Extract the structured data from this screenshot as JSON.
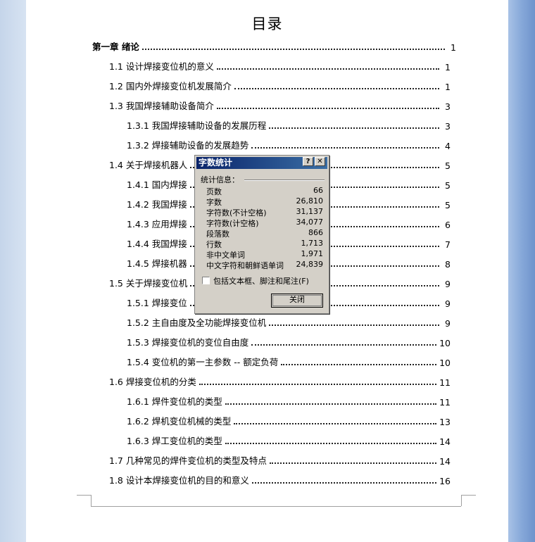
{
  "document": {
    "title": "目录",
    "toc": [
      {
        "text": "第一章  绪论",
        "page": "1"
      },
      {
        "text": "1.1 设计焊接变位机的意义",
        "page": "1"
      },
      {
        "text": "1.2 国内外焊接变位机发展简介",
        "page": "1"
      },
      {
        "text": "1.3 我国焊接辅助设备简介",
        "page": "3"
      },
      {
        "text": "1.3.1 我国焊接辅助设备的发展历程",
        "page": "3"
      },
      {
        "text": "1.3.2 焊接辅助设备的发展趋势",
        "page": "4"
      },
      {
        "text": "1.4 关于焊接机器人",
        "page": "5"
      },
      {
        "text": "1.4.1 国内焊接",
        "page": "5"
      },
      {
        "text": "1.4.2 我国焊接",
        "page": "5"
      },
      {
        "text": "1.4.3 应用焊接",
        "page": "6"
      },
      {
        "text": "1.4.4 我国焊接",
        "page": "7"
      },
      {
        "text": "1.4.5 焊接机器",
        "page": "8"
      },
      {
        "text": "1.5 关于焊接变位机",
        "page": "9"
      },
      {
        "text": "1.5.1 焊接变位",
        "page": "9"
      },
      {
        "text": "1.5.2 主自由度及全功能焊接变位机",
        "page": "9"
      },
      {
        "text": "1.5.3 焊接变位机的变位自由度",
        "page": "10"
      },
      {
        "text": "1.5.4 变位机的第一主参数 -- 额定负荷",
        "page": "10"
      },
      {
        "text": "1.6 焊接变位机的分类",
        "page": "11"
      },
      {
        "text": "1.6.1 焊件变位机的类型",
        "page": "11"
      },
      {
        "text": "1.6.2 焊机变位机械的类型",
        "page": "13"
      },
      {
        "text": "1.6.3 焊工变位机的类型",
        "page": "14"
      },
      {
        "text": "1.7  几种常见的焊件变位机的类型及特点",
        "page": "14"
      },
      {
        "text": "1.8 设计本焊接变位机的目的和意义",
        "page": "16"
      }
    ]
  },
  "dialog": {
    "title": "字数统计",
    "help_glyph": "?",
    "close_glyph": "✕",
    "group_label": "统计信息：",
    "stats": [
      {
        "label": "页数",
        "value": "66"
      },
      {
        "label": "字数",
        "value": "26,810"
      },
      {
        "label": "字符数(不计空格)",
        "value": "31,137"
      },
      {
        "label": "字符数(计空格)",
        "value": "34,077"
      },
      {
        "label": "段落数",
        "value": "866"
      },
      {
        "label": "行数",
        "value": "1,713"
      },
      {
        "label": "非中文单词",
        "value": "1,971"
      },
      {
        "label": "中文字符和朝鲜语单词",
        "value": "24,839"
      }
    ],
    "checkbox_label": "包括文本框、脚注和尾注(F)",
    "checkbox_checked": false,
    "close_button": "关闭"
  }
}
